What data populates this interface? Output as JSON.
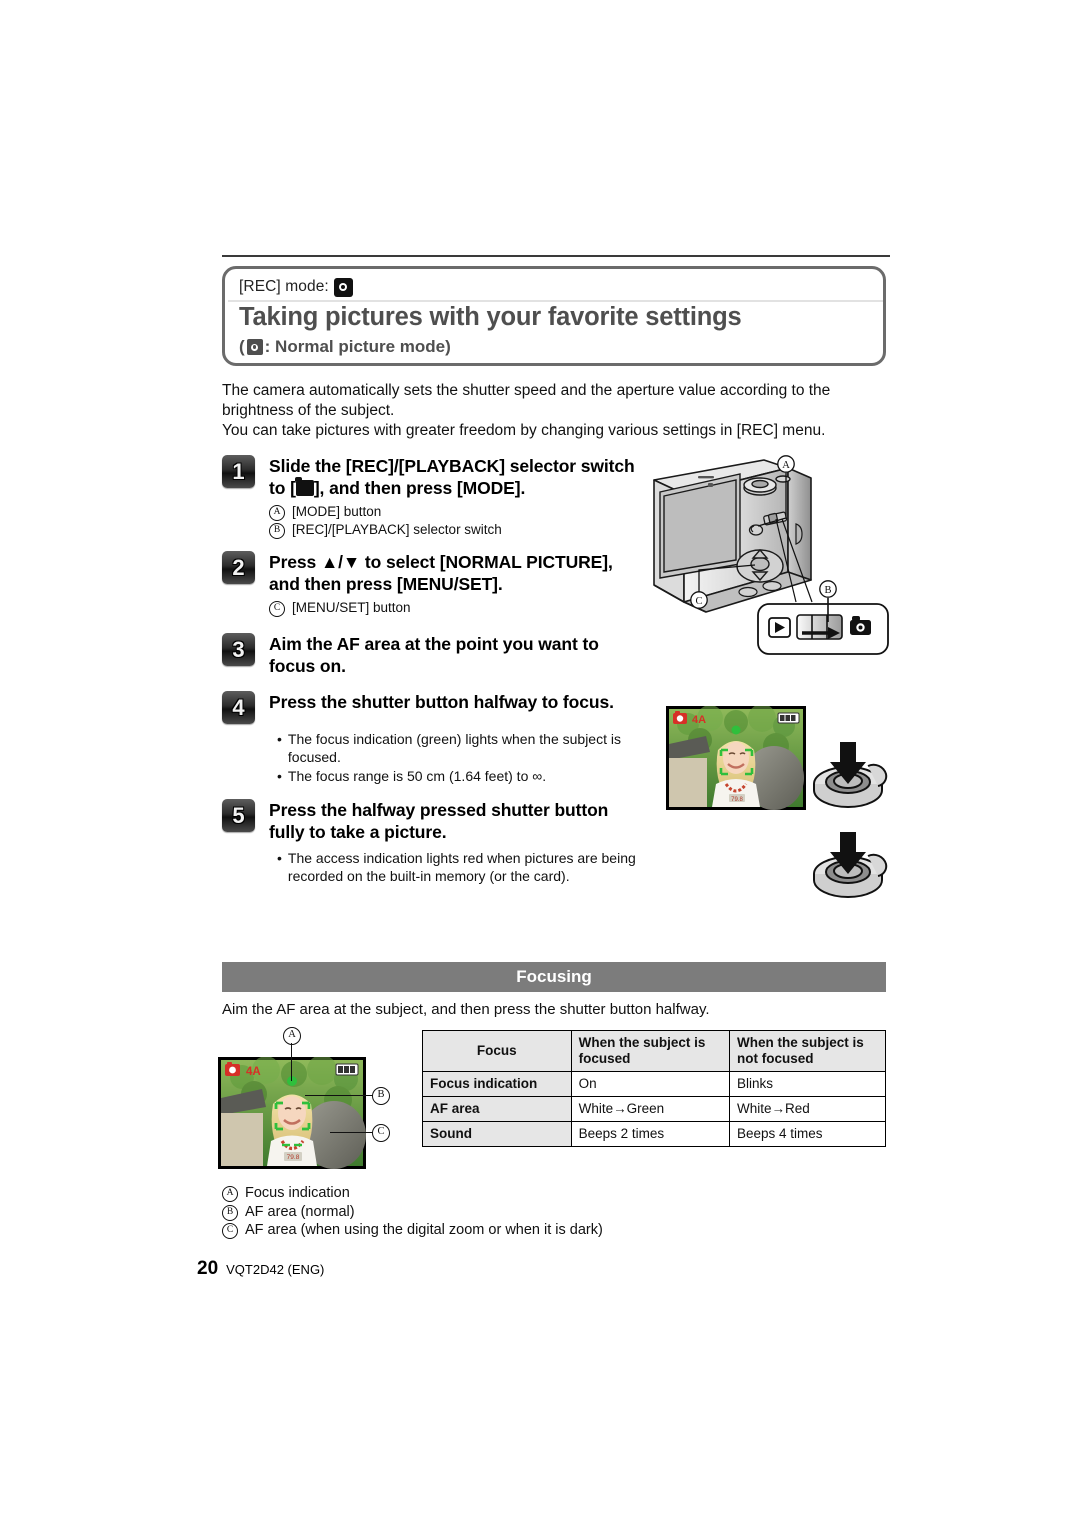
{
  "header": {
    "rec_mode_label": "[REC] mode:",
    "rec_mode_icon": "camera-normal-icon",
    "title": "Taking pictures with your favorite settings",
    "subtitle_prefix": "(",
    "subtitle_icon": "camera-normal-icon",
    "subtitle": ": Normal picture mode)"
  },
  "intro": {
    "line1": "The camera automatically sets the shutter speed and the aperture value according to the brightness of the subject.",
    "line2": "You can take pictures with greater freedom by changing various settings in [REC] menu."
  },
  "steps": [
    {
      "number": "1",
      "title_part1": "Slide the [REC]/[PLAYBACK] selector switch to [",
      "title_icon": "camera-normal-icon",
      "title_part2": "], and then press [MODE].",
      "notes": [
        {
          "marker": "A",
          "text": "[MODE] button"
        },
        {
          "marker": "B",
          "text": "[REC]/[PLAYBACK] selector switch"
        }
      ],
      "bullets": []
    },
    {
      "number": "2",
      "title": "Press ▲/▼ to select [NORMAL PICTURE], and then press [MENU/SET].",
      "notes": [
        {
          "marker": "C",
          "text": "[MENU/SET] button"
        }
      ],
      "bullets": []
    },
    {
      "number": "3",
      "title": "Aim the AF area at the point you want to focus on.",
      "notes": [],
      "bullets": []
    },
    {
      "number": "4",
      "title": "Press the shutter button halfway to focus.",
      "notes": [],
      "bullets": [
        "The focus indication (green) lights when the subject is focused.",
        "The focus range is 50 cm (1.64 feet) to ∞."
      ]
    },
    {
      "number": "5",
      "title": "Press the halfway pressed shutter button fully to take a picture.",
      "notes": [],
      "bullets": [
        "The access indication lights red when pictures are being recorded on the built-in memory (or the card)."
      ]
    }
  ],
  "camera_figure": {
    "callout_a": "A",
    "callout_b": "B",
    "callout_c": "C",
    "switch_playback_icon": "playback-triangle-icon",
    "switch_rec_icon": "camera-solid-icon"
  },
  "focusing": {
    "banner": "Focusing",
    "lead": "Aim the AF area at the subject, and then press the shutter button halfway.",
    "table": {
      "headers": [
        "Focus",
        "When the subject is focused",
        "When the subject is not focused"
      ],
      "rows": [
        {
          "label": "Focus indication",
          "focused": "On",
          "not_focused": "Blinks"
        },
        {
          "label": "AF area",
          "focused": "White→Green",
          "not_focused": "White→Red"
        },
        {
          "label": "Sound",
          "focused": "Beeps 2 times",
          "not_focused": "Beeps 4 times"
        }
      ]
    },
    "callouts": {
      "a": "A",
      "b": "B",
      "c": "C"
    },
    "legend": [
      {
        "marker": "A",
        "text": "Focus indication"
      },
      {
        "marker": "B",
        "text": "AF area (normal)"
      },
      {
        "marker": "C",
        "text": "AF area (when using the digital zoom or when it is dark)"
      }
    ]
  },
  "footer": {
    "page_number": "20",
    "doc_code": "VQT2D42 (ENG)"
  },
  "colors": {
    "banner_bg": "#7c7c7c",
    "title_text": "#4f4f4f",
    "table_header_bg": "#e6e6e6",
    "box_border": "#6b6b6b"
  }
}
